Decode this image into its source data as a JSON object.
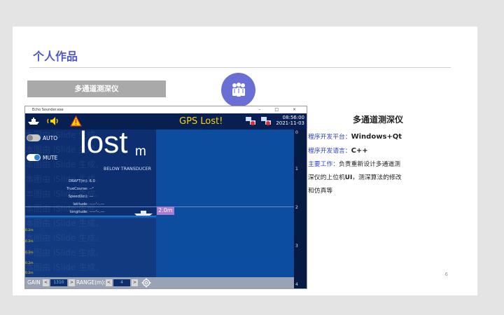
{
  "slide": {
    "title": "个人作品",
    "tag": "多通道测深仪",
    "page_number": "6",
    "badge_icon": "people-group-icon",
    "accent_color": "#4f59c8"
  },
  "description": {
    "title": "多通道测深仪",
    "platform_key": "程序开发平台：",
    "platform_value": "Windows+Qt",
    "language_key": "程序开发语言：",
    "language_value": "C++",
    "work_key": "主要工作：",
    "work_line1": "负责重新设计多通道测",
    "work_line2": "深仪的上位机",
    "work_line2_bold": "UI",
    "work_line2_rest": "，测深算法的修改",
    "work_line3": "和仿真等"
  },
  "window": {
    "title": "Echo Sounder.exe",
    "controls": "– □ ×"
  },
  "app": {
    "gps_status": "GPS Lost!",
    "time": "08:56:00",
    "date": "2021-11-03",
    "auto_label": "AUTO",
    "mute_label": "MUTE",
    "depth_value": "lost",
    "depth_unit": "m",
    "below_label": "BELOW TRANSDUCER",
    "info_rows": [
      {
        "key": "DRAFT(m):",
        "value": "6.0"
      },
      {
        "key": "TrueCourse:",
        "value": "--°"
      },
      {
        "key": "Speed(kn):",
        "value": "---"
      },
      {
        "key": "latitude:",
        "value": "--·--'--.---"
      },
      {
        "key": "longitude:",
        "value": "--·--'--.---"
      }
    ],
    "marker": "2.0m",
    "scale_labels": [
      "0",
      "1",
      "2",
      "3",
      "4"
    ],
    "left_ticks": [
      "0.2m",
      "0.2m",
      "0.2m",
      "0.2m",
      "0.2m"
    ],
    "gain_label": "GAIN",
    "gain_value": "1310",
    "range_label": "RANGE(m):",
    "range_value": "4",
    "watermark": "本图由 iSlide 生成。"
  }
}
